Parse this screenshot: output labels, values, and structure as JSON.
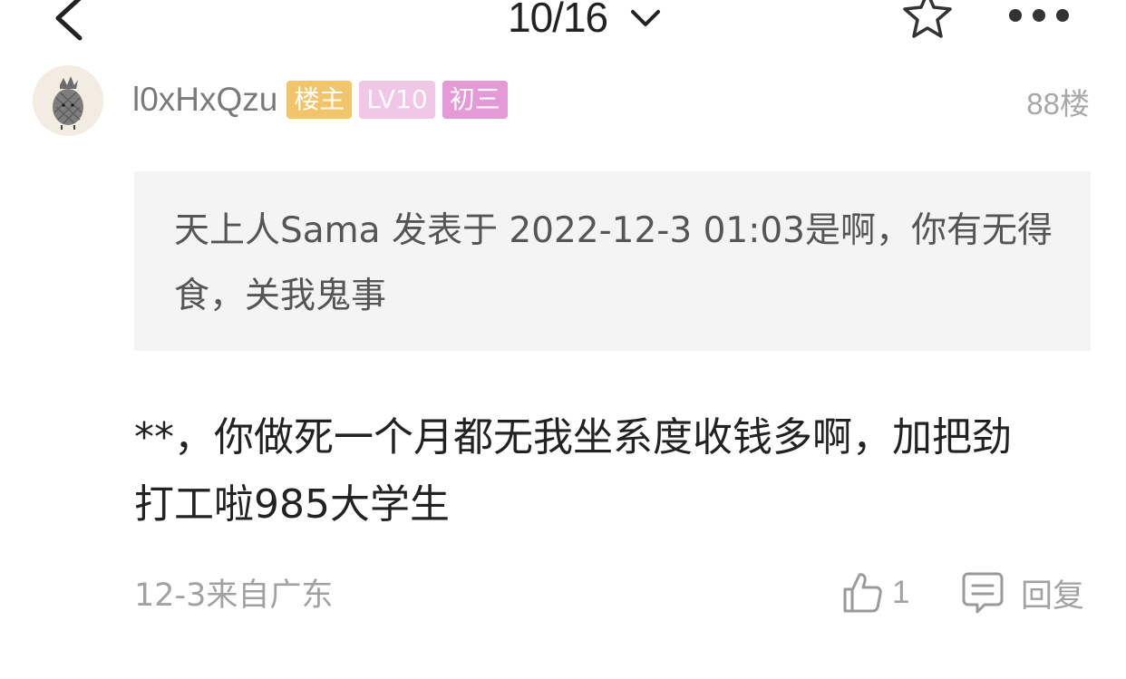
{
  "header": {
    "page_indicator": "10/16",
    "icons": {
      "back": "chevron-left-icon",
      "dropdown": "chevron-down-icon",
      "favorite": "star-icon",
      "more": "more-horizontal-icon"
    }
  },
  "post": {
    "avatar": {
      "icon": "pineapple-avatar",
      "bg_color": "#f3ece3"
    },
    "username": "l0xHxQzu",
    "badges": [
      {
        "label": "楼主",
        "color": "#f3c56b"
      },
      {
        "label": "LV10",
        "color": "#f0c7e6"
      },
      {
        "label": "初三",
        "color": "#e39ad6"
      }
    ],
    "floor": "88楼",
    "quote": {
      "text": "天上人Sama 发表于 2022-12-3 01:03是啊，你有无得食，关我鬼事"
    },
    "content": "**，你做死一个月都无我坐系度收钱多啊，加把劲打工啦985大学生",
    "meta": "12-3来自广东",
    "like_count": "1",
    "reply_label": "回复"
  }
}
